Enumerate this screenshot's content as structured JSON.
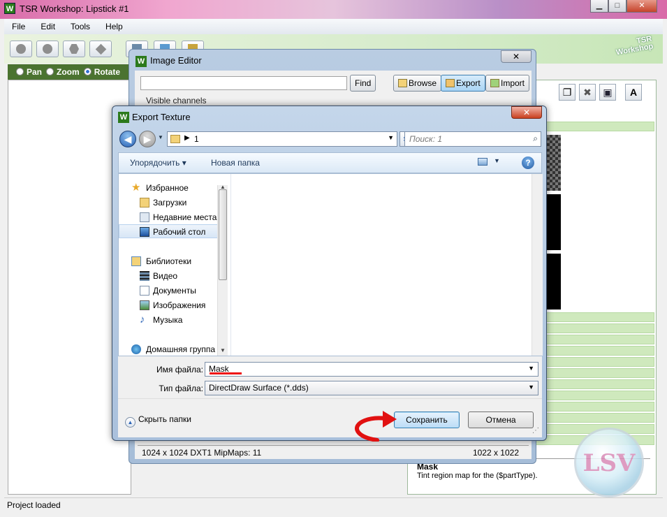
{
  "main_window": {
    "title": "TSR Workshop: Lipstick #1",
    "app_icon_letter": "W",
    "controls": {
      "minimize": "▁",
      "maximize": "□",
      "close": "✕"
    },
    "menu": [
      "File",
      "Edit",
      "Tools",
      "Help"
    ],
    "logo_lines": [
      "TSR",
      "Workshop"
    ],
    "modes": [
      {
        "label": "Pan",
        "checked": false
      },
      {
        "label": "Zoom",
        "checked": false
      },
      {
        "label": "Rotate",
        "checked": true
      }
    ],
    "right_toolbar_text_button": "A",
    "mask_panel": {
      "name": "Mask",
      "description": "Tint region map for the ($partType)."
    },
    "status": "Project loaded"
  },
  "image_editor": {
    "title": "Image Editor",
    "app_icon_letter": "W",
    "close_glyph": "✕",
    "search_value": "",
    "buttons": {
      "find": "Find",
      "browse": "Browse",
      "export": "Export",
      "import": "Import"
    },
    "visible_channels_label": "Visible channels",
    "status_left": "1024 x 1024 DXT1 MipMaps: 11",
    "status_right": "1022 x 1022"
  },
  "export_dialog": {
    "title": "Export Texture",
    "app_icon_letter": "W",
    "close_glyph": "✕",
    "address_crumb": "1",
    "search_placeholder": "Поиск: 1",
    "commandbar": {
      "organize": "Упорядочить ▾",
      "new_folder": "Новая папка",
      "help": "?"
    },
    "nav_groups": [
      {
        "label": "Избранное",
        "type": "star"
      },
      {
        "label": "Загрузки",
        "type": "folder-download"
      },
      {
        "label": "Недавние места",
        "type": "recent"
      },
      {
        "label": "Рабочий стол",
        "type": "desktop",
        "selected": true
      },
      {
        "label": "Библиотеки",
        "type": "library"
      },
      {
        "label": "Видео",
        "type": "video"
      },
      {
        "label": "Документы",
        "type": "documents"
      },
      {
        "label": "Изображения",
        "type": "images"
      },
      {
        "label": "Музыка",
        "type": "music"
      },
      {
        "label": "Домашняя группа",
        "type": "homegroup"
      }
    ],
    "filename_label": "Имя файла:",
    "filename_value": "Mask",
    "filetype_label": "Тип файла:",
    "filetype_value": "DirectDraw Surface (*.dds)",
    "hide_folders": "Скрыть папки",
    "save_button": "Сохранить",
    "cancel_button": "Отмена"
  },
  "watermark": {
    "text": "LSV"
  },
  "colors": {
    "accent_green": "#4b7330",
    "annotation_red": "#e11111",
    "save_button_blue": "#3c7fb1"
  }
}
